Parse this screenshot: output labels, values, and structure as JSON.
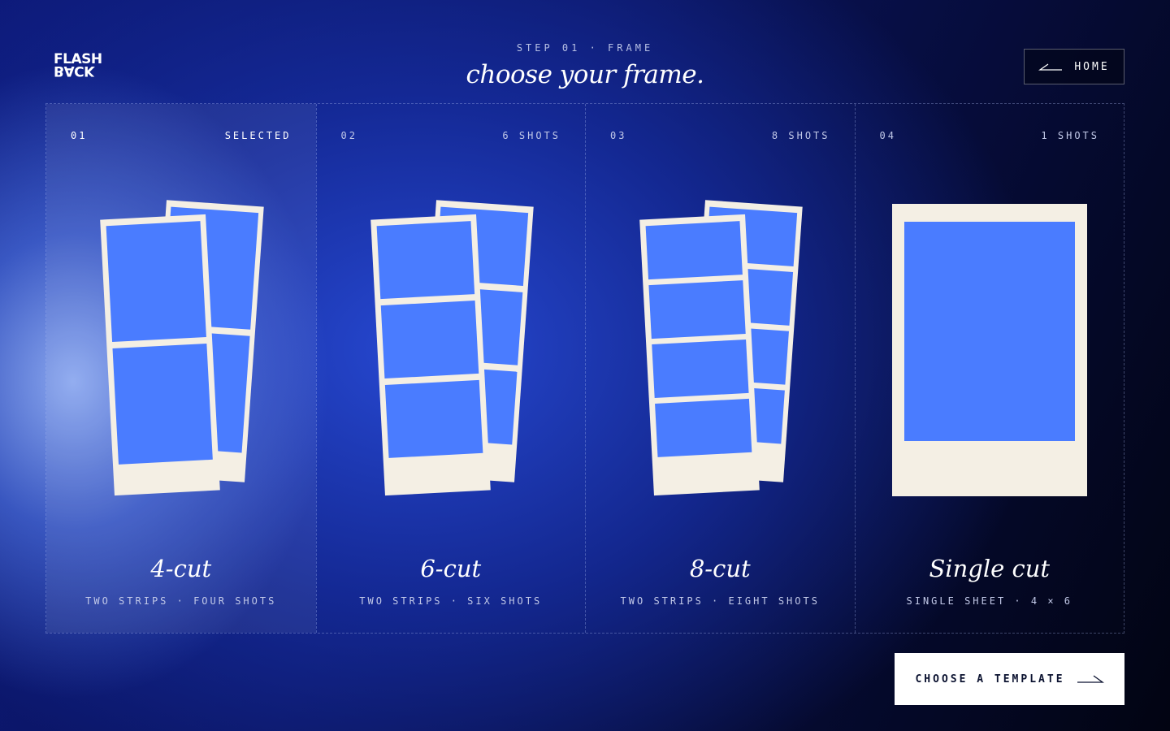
{
  "brand": {
    "logo_top": "FLASH",
    "logo_bottom": "BACK"
  },
  "header": {
    "step": "STEP 01 · FRAME",
    "headline": "choose your frame.",
    "home_label": "HOME"
  },
  "cards": [
    {
      "num": "01",
      "meta": "SELECTED",
      "title": "4-cut",
      "sub": "TWO STRIPS · FOUR SHOTS",
      "selected": true
    },
    {
      "num": "02",
      "meta": "6 SHOTS",
      "title": "6-cut",
      "sub": "TWO STRIPS · SIX SHOTS",
      "selected": false
    },
    {
      "num": "03",
      "meta": "8 SHOTS",
      "title": "8-cut",
      "sub": "TWO STRIPS · EIGHT SHOTS",
      "selected": false
    },
    {
      "num": "04",
      "meta": "1 SHOTS",
      "title": "Single cut",
      "sub": "SINGLE SHEET · 4 × 6",
      "selected": false
    }
  ],
  "cta": {
    "label": "CHOOSE A TEMPLATE"
  },
  "colors": {
    "paper": "#f4efe4",
    "photo": "#4a7cff",
    "accent": "#ffffff"
  }
}
